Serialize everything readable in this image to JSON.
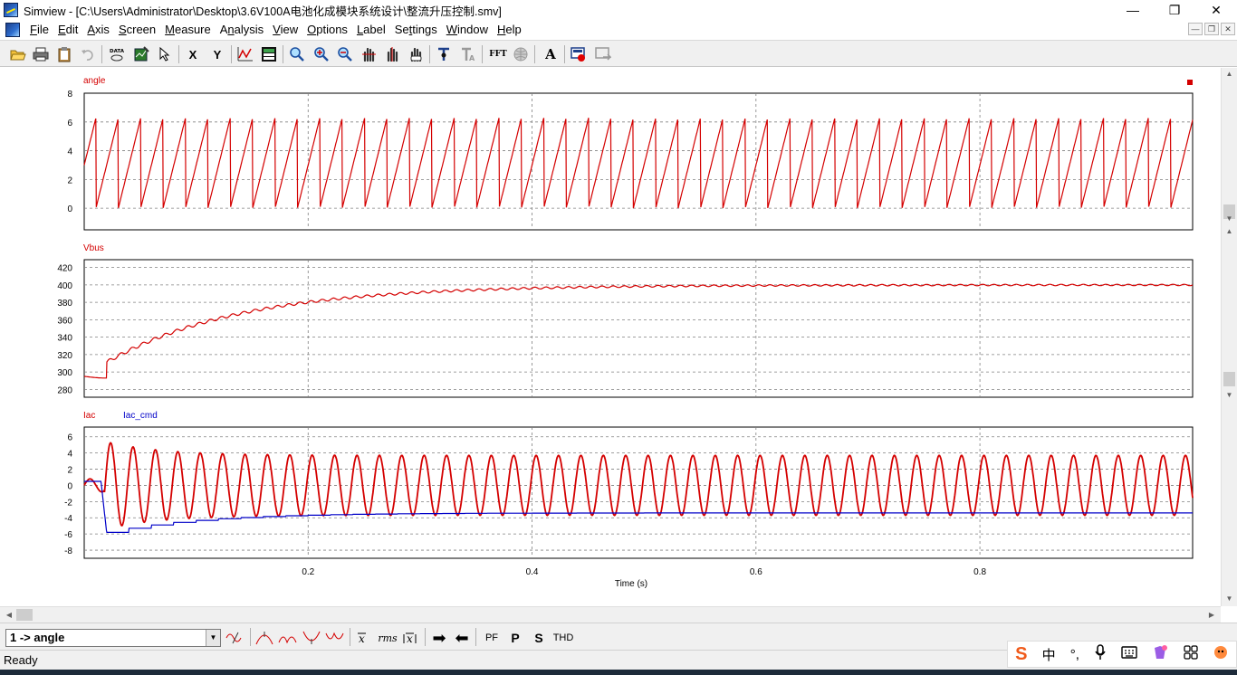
{
  "window": {
    "title": "Simview - [C:\\Users\\Administrator\\Desktop\\3.6V100A电池化成模块系统设计\\整流升压控制.smv]",
    "controls": [
      "—",
      "❐",
      "✕"
    ],
    "mdi_controls": [
      "—",
      "❐",
      "✕"
    ]
  },
  "menu": [
    {
      "label": "File",
      "key": "F"
    },
    {
      "label": "Edit",
      "key": "E"
    },
    {
      "label": "Axis",
      "key": "A"
    },
    {
      "label": "Screen",
      "key": "S"
    },
    {
      "label": "Measure",
      "key": "M"
    },
    {
      "label": "Analysis",
      "key": "n"
    },
    {
      "label": "View",
      "key": "V"
    },
    {
      "label": "Options",
      "key": "O"
    },
    {
      "label": "Label",
      "key": "L"
    },
    {
      "label": "Settings",
      "key": "t"
    },
    {
      "label": "Window",
      "key": "W"
    },
    {
      "label": "Help",
      "key": "H"
    }
  ],
  "toolbar": {
    "x_label": "X",
    "y_label": "Y",
    "fft_label": "FFT",
    "text_label": "A",
    "data_label": "DATA"
  },
  "colors": {
    "red": "#d40000",
    "blue": "#0000c8",
    "grid": "#808080"
  },
  "chart_data": [
    {
      "type": "line",
      "name": "angle",
      "series": [
        {
          "name": "angle",
          "color": "#d40000",
          "shape": "sawtooth",
          "frequency_hz": 50,
          "min": 0,
          "max": 6.2832,
          "phase_start": 3.0
        }
      ],
      "xlim": [
        0,
        0.99
      ],
      "ylim": [
        -1.5,
        8
      ],
      "yticks": [
        0,
        2,
        4,
        6,
        8
      ],
      "grid": true
    },
    {
      "type": "line",
      "name": "Vbus",
      "series": [
        {
          "name": "Vbus",
          "color": "#d40000",
          "shape": "first-order rise",
          "start": 295,
          "final": 400,
          "time_constant_s": 0.12,
          "ripple_pp_start": 4,
          "ripple_pp_end": 1.5,
          "ripple_frequency_hz": 100
        }
      ],
      "xlim": [
        0,
        0.99
      ],
      "ylim": [
        271,
        429
      ],
      "yticks": [
        280,
        300,
        320,
        340,
        360,
        380,
        400,
        420
      ],
      "grid": true
    },
    {
      "type": "line",
      "name": "Iac",
      "series": [
        {
          "name": "Iac",
          "color": "#d40000",
          "shape": "damped sinusoid",
          "frequency_hz": 50,
          "amplitude_start": 6.2,
          "amplitude_final": 3.7,
          "decay_s": 0.05
        },
        {
          "name": "Iac_cmd",
          "color": "#0000c8",
          "shape": "step approach",
          "initial_drop_to": -5.8,
          "final": -3.4,
          "settle_s": 0.25
        }
      ],
      "xlim": [
        0,
        0.99
      ],
      "ylim": [
        -9,
        7.2
      ],
      "yticks": [
        -8,
        -6,
        -4,
        -2,
        0,
        2,
        4,
        6
      ],
      "xticks": [
        0.2,
        0.4,
        0.6,
        0.8
      ],
      "xlabel": "Time (s)",
      "grid": true
    }
  ],
  "bottom": {
    "selected_variable": "1 -> angle",
    "buttons": [
      "PF",
      "P",
      "S",
      "THD",
      "rms"
    ]
  },
  "status": {
    "text": "Ready"
  },
  "ime": {
    "items": [
      "中",
      "°,"
    ]
  }
}
